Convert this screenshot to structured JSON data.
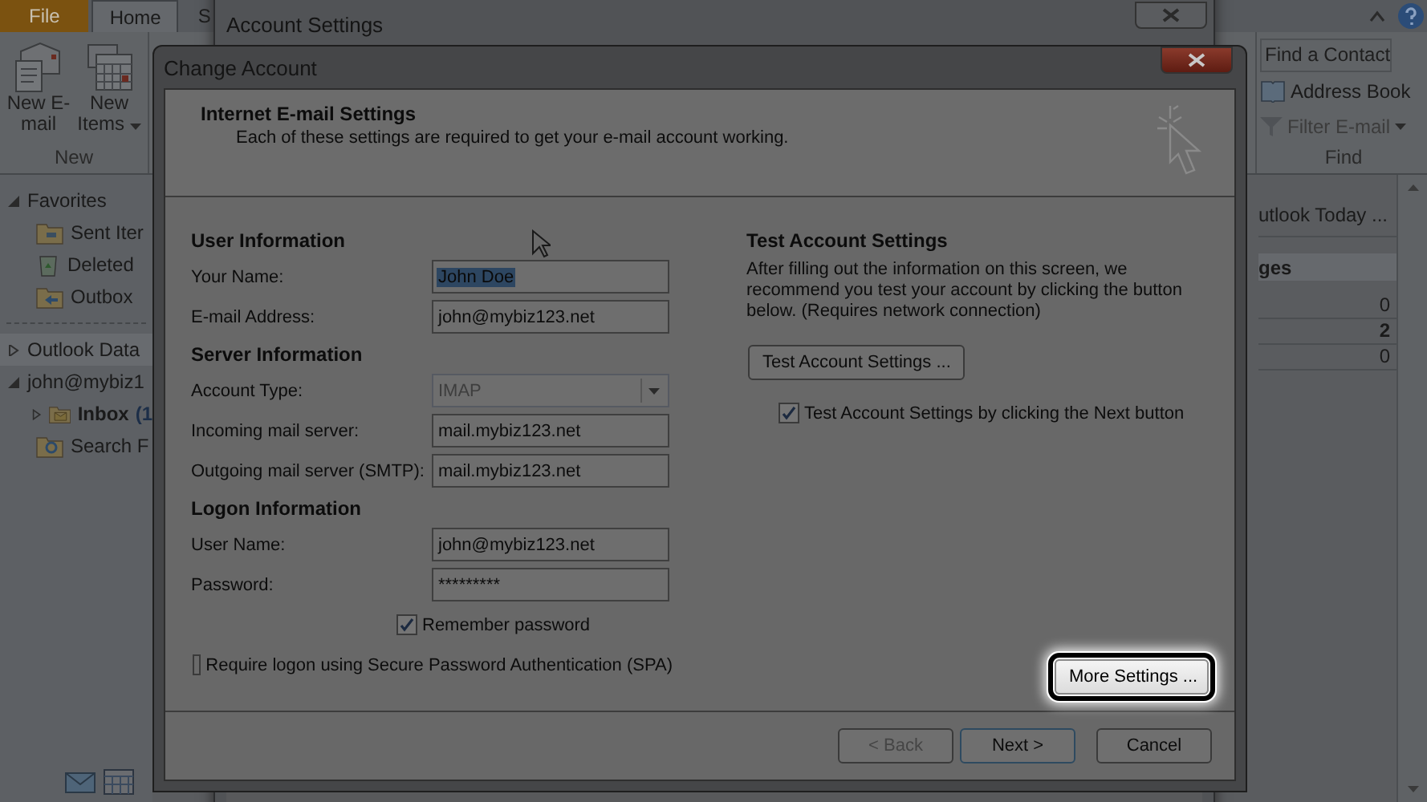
{
  "outlook": {
    "tabs": [
      {
        "label": "File",
        "kind": "file",
        "selected": false
      },
      {
        "label": "Home",
        "kind": "tab",
        "selected": true
      },
      {
        "label": "S",
        "kind": "tab",
        "selected": false
      }
    ],
    "new_group": {
      "name": "New",
      "buttons": [
        {
          "label": "New E-mail",
          "kind": "mail",
          "dropdown": false
        },
        {
          "label": "New Items",
          "kind": "items",
          "dropdown": true
        }
      ]
    },
    "find_group": {
      "name": "Find",
      "items": [
        {
          "label": "Find a Contact",
          "kind": "field"
        },
        {
          "label": "Address Book",
          "kind": "book"
        },
        {
          "label": "Filter E-mail",
          "kind": "filter"
        }
      ]
    },
    "nav": {
      "favorites": {
        "label": "Favorites",
        "expanded": true,
        "items": [
          {
            "label": "Sent Iter",
            "kind": "sent"
          },
          {
            "label": "Deleted",
            "kind": "deleted"
          },
          {
            "label": "Outbox",
            "kind": "outbox"
          }
        ]
      },
      "data_file": {
        "label": "Outlook Data",
        "expanded": false
      },
      "account": {
        "label": "john@mybiz1",
        "expanded": true,
        "items": [
          {
            "label": "Inbox",
            "count": "(1",
            "kind": "inbox",
            "expanded": false
          },
          {
            "label": "Search F",
            "kind": "search"
          }
        ]
      }
    },
    "today": {
      "link": "utlook Today ...",
      "heading": "ges",
      "counts": [
        {
          "value": "0",
          "bold": false
        },
        {
          "value": "2",
          "bold": true
        },
        {
          "value": "0",
          "bold": false
        }
      ]
    }
  },
  "account_settings": {
    "title": "Account Settings"
  },
  "dialog": {
    "title": "Change Account",
    "header": {
      "title": "Internet E-mail Settings",
      "subtitle": "Each of these settings are required to get your e-mail account working."
    },
    "sections": [
      {
        "heading": "User Information",
        "fields": [
          {
            "label": "Your Name:",
            "value": "John Doe",
            "kind": "text",
            "disabled": false,
            "text_selected": true
          },
          {
            "label": "E-mail Address:",
            "value": "john@mybiz123.net",
            "kind": "text",
            "disabled": false,
            "text_selected": false
          }
        ]
      },
      {
        "heading": "Server Information",
        "fields": [
          {
            "label": "Account Type:",
            "value": "IMAP",
            "kind": "select",
            "disabled": true,
            "text_selected": false
          },
          {
            "label": "Incoming mail server:",
            "value": "mail.mybiz123.net",
            "kind": "text",
            "disabled": false,
            "text_selected": false
          },
          {
            "label": "Outgoing mail server (SMTP):",
            "value": "mail.mybiz123.net",
            "kind": "text",
            "disabled": false,
            "text_selected": false
          }
        ]
      },
      {
        "heading": "Logon Information",
        "fields": [
          {
            "label": "User Name:",
            "value": "john@mybiz123.net",
            "kind": "text",
            "disabled": false,
            "text_selected": false
          },
          {
            "label": "Password:",
            "value": "*********",
            "kind": "password",
            "disabled": false,
            "text_selected": false
          }
        ]
      }
    ],
    "remember_password": {
      "label": "Remember password",
      "checked": true
    },
    "spa": {
      "label": "Require logon using Secure Password Authentication (SPA)",
      "checked": false
    },
    "test": {
      "heading": "Test Account Settings",
      "text": "After filling out the information on this screen, we recommend you test your account by clicking the button below. (Requires network connection)",
      "button": "Test Account Settings ...",
      "next_check": {
        "label": "Test Account Settings by clicking the Next button",
        "checked": true
      }
    },
    "more_settings": {
      "label": "More Settings ...",
      "highlighted": true
    },
    "buttons": [
      {
        "label": "< Back",
        "disabled": true,
        "default": false
      },
      {
        "label": "Next >",
        "disabled": false,
        "default": true
      },
      {
        "label": "Cancel",
        "disabled": false,
        "default": false
      }
    ]
  }
}
